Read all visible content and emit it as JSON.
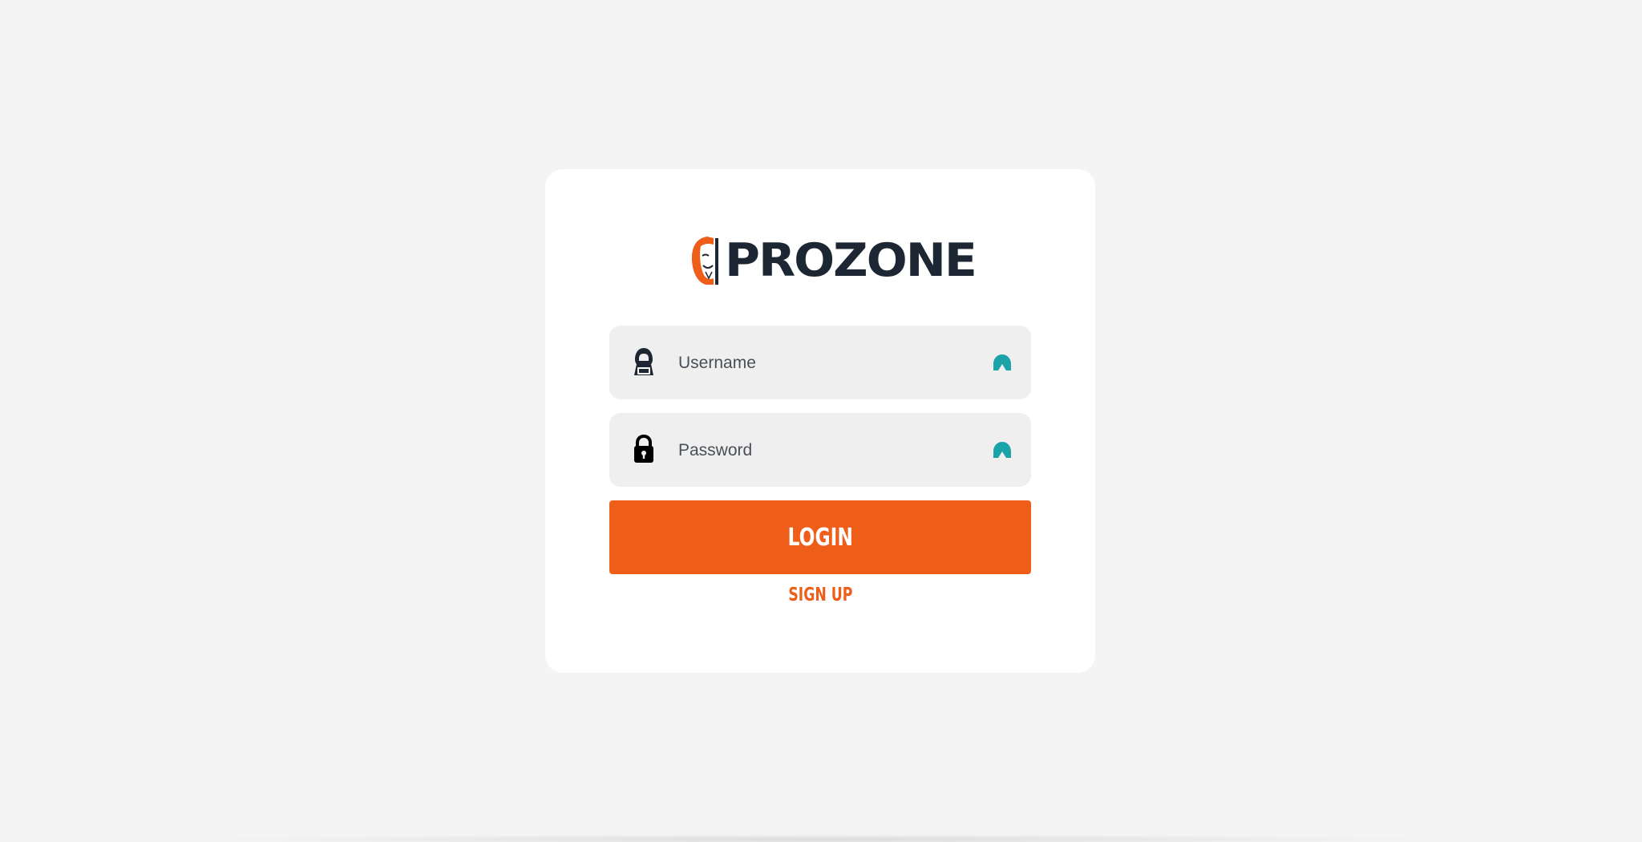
{
  "logo": {
    "text": "PROZONE"
  },
  "form": {
    "username": {
      "placeholder": "Username",
      "value": "",
      "icon": "hacker-icon"
    },
    "password": {
      "placeholder": "Password",
      "value": "",
      "icon": "lock-icon"
    },
    "login_label": "LOGIN",
    "signup_label": "SIGN UP",
    "password_manager_icon": "password-manager-icon"
  },
  "colors": {
    "accent": "#ee5e19",
    "brand_dark": "#1c2733",
    "field_bg": "#efefef",
    "page_bg": "#f4f4f4",
    "pm_icon": "#1aa3a8"
  }
}
